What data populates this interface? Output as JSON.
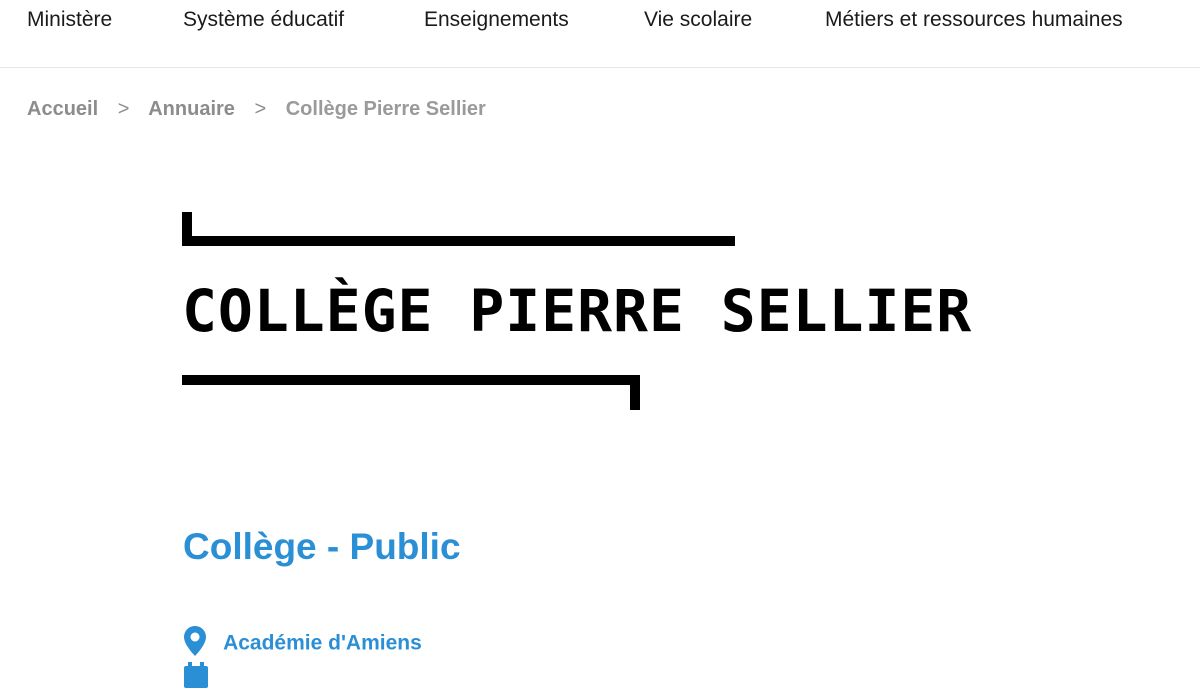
{
  "nav": {
    "items": [
      {
        "label": "Ministère"
      },
      {
        "label": "Système éducatif"
      },
      {
        "label": "Enseignements"
      },
      {
        "label": "Vie scolaire"
      },
      {
        "label": "Métiers et ressources humaines"
      }
    ]
  },
  "breadcrumb": {
    "items": [
      "Accueil",
      "Annuaire",
      "Collège Pierre Sellier"
    ],
    "separator": ">"
  },
  "school": {
    "title": "COLLÈGE PIERRE SELLIER",
    "type": "Collège - Public",
    "academie": "Académie d'Amiens",
    "academie_icon": "map-pin-icon",
    "next_icon": "calendar-icon",
    "accent_color": "#2b8fd6"
  }
}
